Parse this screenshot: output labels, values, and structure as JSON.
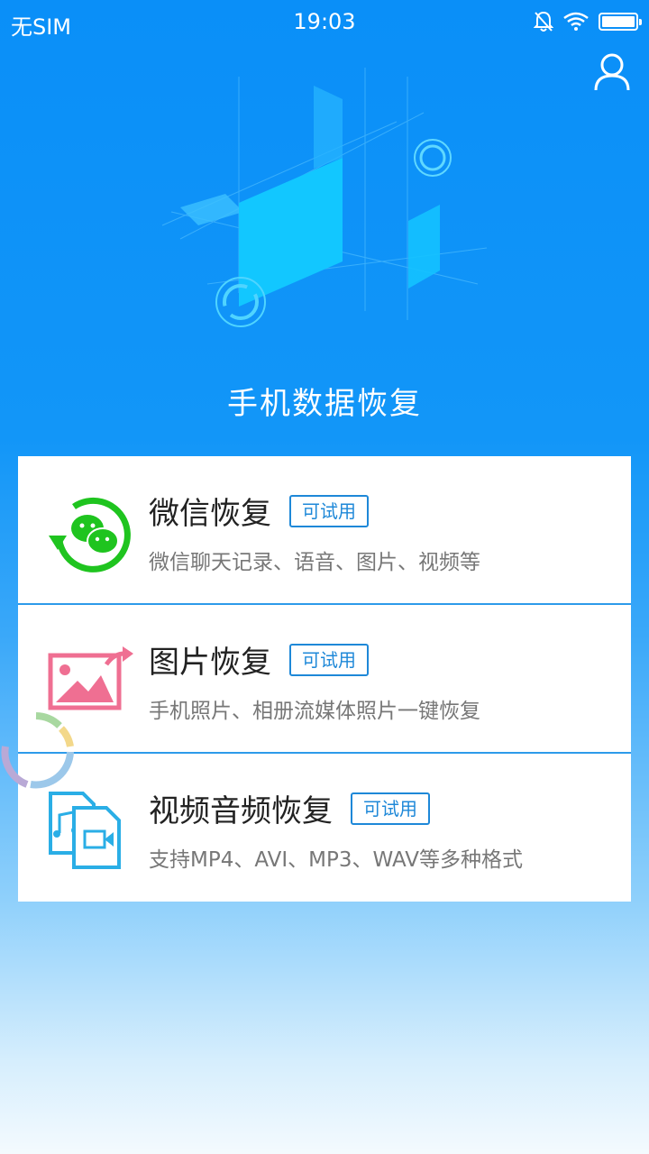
{
  "status_bar": {
    "carrier": "无SIM",
    "time": "19:03",
    "icons": [
      "mute-bell-icon",
      "wifi-icon",
      "battery-icon"
    ]
  },
  "header": {
    "user_icon": "user-icon",
    "title": "手机数据恢复"
  },
  "features": [
    {
      "icon": "wechat-recovery-icon",
      "title": "微信恢复",
      "badge": "可试用",
      "description": "微信聊天记录、语音、图片、视频等"
    },
    {
      "icon": "photo-recovery-icon",
      "title": "图片恢复",
      "badge": "可试用",
      "description": "手机照片、相册流媒体照片一键恢复"
    },
    {
      "icon": "video-audio-file-icon",
      "title": "视频音频恢复",
      "badge": "可试用",
      "description": "支持MP4、AVI、MP3、WAV等多种格式"
    }
  ],
  "colors": {
    "primary_blue": "#0a8ff8",
    "badge_blue": "#1e88d8",
    "wechat_green": "#1fc41f",
    "photo_pink": "#ef6f92",
    "video_cyan": "#2aaee6"
  }
}
